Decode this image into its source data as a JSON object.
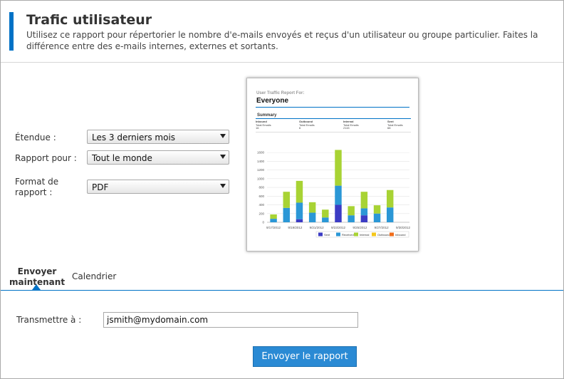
{
  "header": {
    "title": "Trafic utilisateur",
    "description": "Utilisez ce rapport pour répertorier le nombre d'e-mails envoyés et reçus d'un utilisateur ou groupe particulier. Faites la différence entre des e-mails internes, externes et sortants."
  },
  "form": {
    "scope_label": "Étendue :",
    "scope_value": "Les 3 derniers mois",
    "report_for_label": "Rapport pour :",
    "report_for_value": "Tout le monde",
    "format_label": "Format de rapport :",
    "format_value": "PDF"
  },
  "preview": {
    "subtitle": "User Traffic Report For:",
    "name": "Everyone",
    "summary_label": "Summary",
    "columns": [
      {
        "header": "Inbound",
        "label": "Total Emails",
        "value": "16"
      },
      {
        "header": "Outbound",
        "label": "Total Emails",
        "value": "6"
      },
      {
        "header": "Internal",
        "label": "Total Emails",
        "value": "2115"
      },
      {
        "header": "Sent",
        "label": "Total Emails",
        "value": "68"
      }
    ]
  },
  "chart_data": {
    "type": "bar",
    "stacked": true,
    "y_ticks": [
      "0",
      "200",
      "400",
      "600",
      "800",
      "1000",
      "1200",
      "1400",
      "1600"
    ],
    "ylim": [
      0,
      1700
    ],
    "x_labels": [
      "9/17/2012",
      "9/19/2012",
      "9/21/2012",
      "9/23/2012",
      "9/25/2012",
      "9/27/2012",
      "9/30/2012"
    ],
    "colors": {
      "Sent": "#3b3bc4",
      "Received": "#2b97d6",
      "Internal": "#a8d334",
      "Outbound": "#f5c71a",
      "Inbound": "#f06d1a"
    },
    "series_names": [
      "Sent",
      "Received",
      "Internal",
      "Outbound",
      "Inbound"
    ],
    "bars": [
      {
        "Sent": 0,
        "Received": 80,
        "Internal": 100
      },
      {
        "Sent": 0,
        "Received": 330,
        "Internal": 370
      },
      {
        "Sent": 70,
        "Received": 380,
        "Internal": 500
      },
      {
        "Sent": 0,
        "Received": 220,
        "Internal": 240
      },
      {
        "Sent": 0,
        "Received": 110,
        "Internal": 180
      },
      {
        "Sent": 400,
        "Received": 440,
        "Internal": 820
      },
      {
        "Sent": 0,
        "Received": 160,
        "Internal": 210
      },
      {
        "Sent": 160,
        "Received": 160,
        "Internal": 380
      },
      {
        "Sent": 0,
        "Received": 200,
        "Internal": 190
      },
      {
        "Sent": 0,
        "Received": 340,
        "Internal": 400
      },
      {
        "Sent": 0,
        "Received": 0,
        "Internal": 0
      }
    ],
    "grid": true,
    "legend_position": "bottom-right"
  },
  "tabs": {
    "send_now": "Envoyer maintenant",
    "calendar": "Calendrier"
  },
  "send": {
    "to_label": "Transmettre à :",
    "to_value": "jsmith@mydomain.com",
    "button_label": "Envoyer le rapport"
  }
}
